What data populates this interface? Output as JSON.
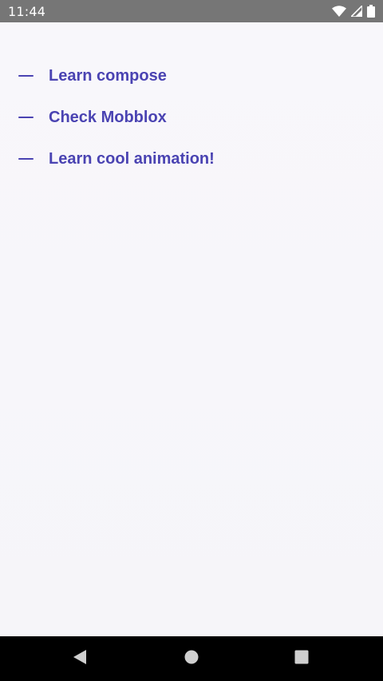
{
  "status_bar": {
    "time": "11:44",
    "icons": [
      "wifi-icon",
      "signal-icon",
      "battery-icon"
    ],
    "background": "#767676"
  },
  "todo": {
    "accent_color": "#4a43b2",
    "items": [
      {
        "label": "Learn compose"
      },
      {
        "label": "Check Mobblox"
      },
      {
        "label": "Learn cool animation!"
      }
    ]
  },
  "nav_bar": {
    "buttons": [
      "back-icon",
      "home-icon",
      "recents-icon"
    ],
    "background": "#000000"
  }
}
